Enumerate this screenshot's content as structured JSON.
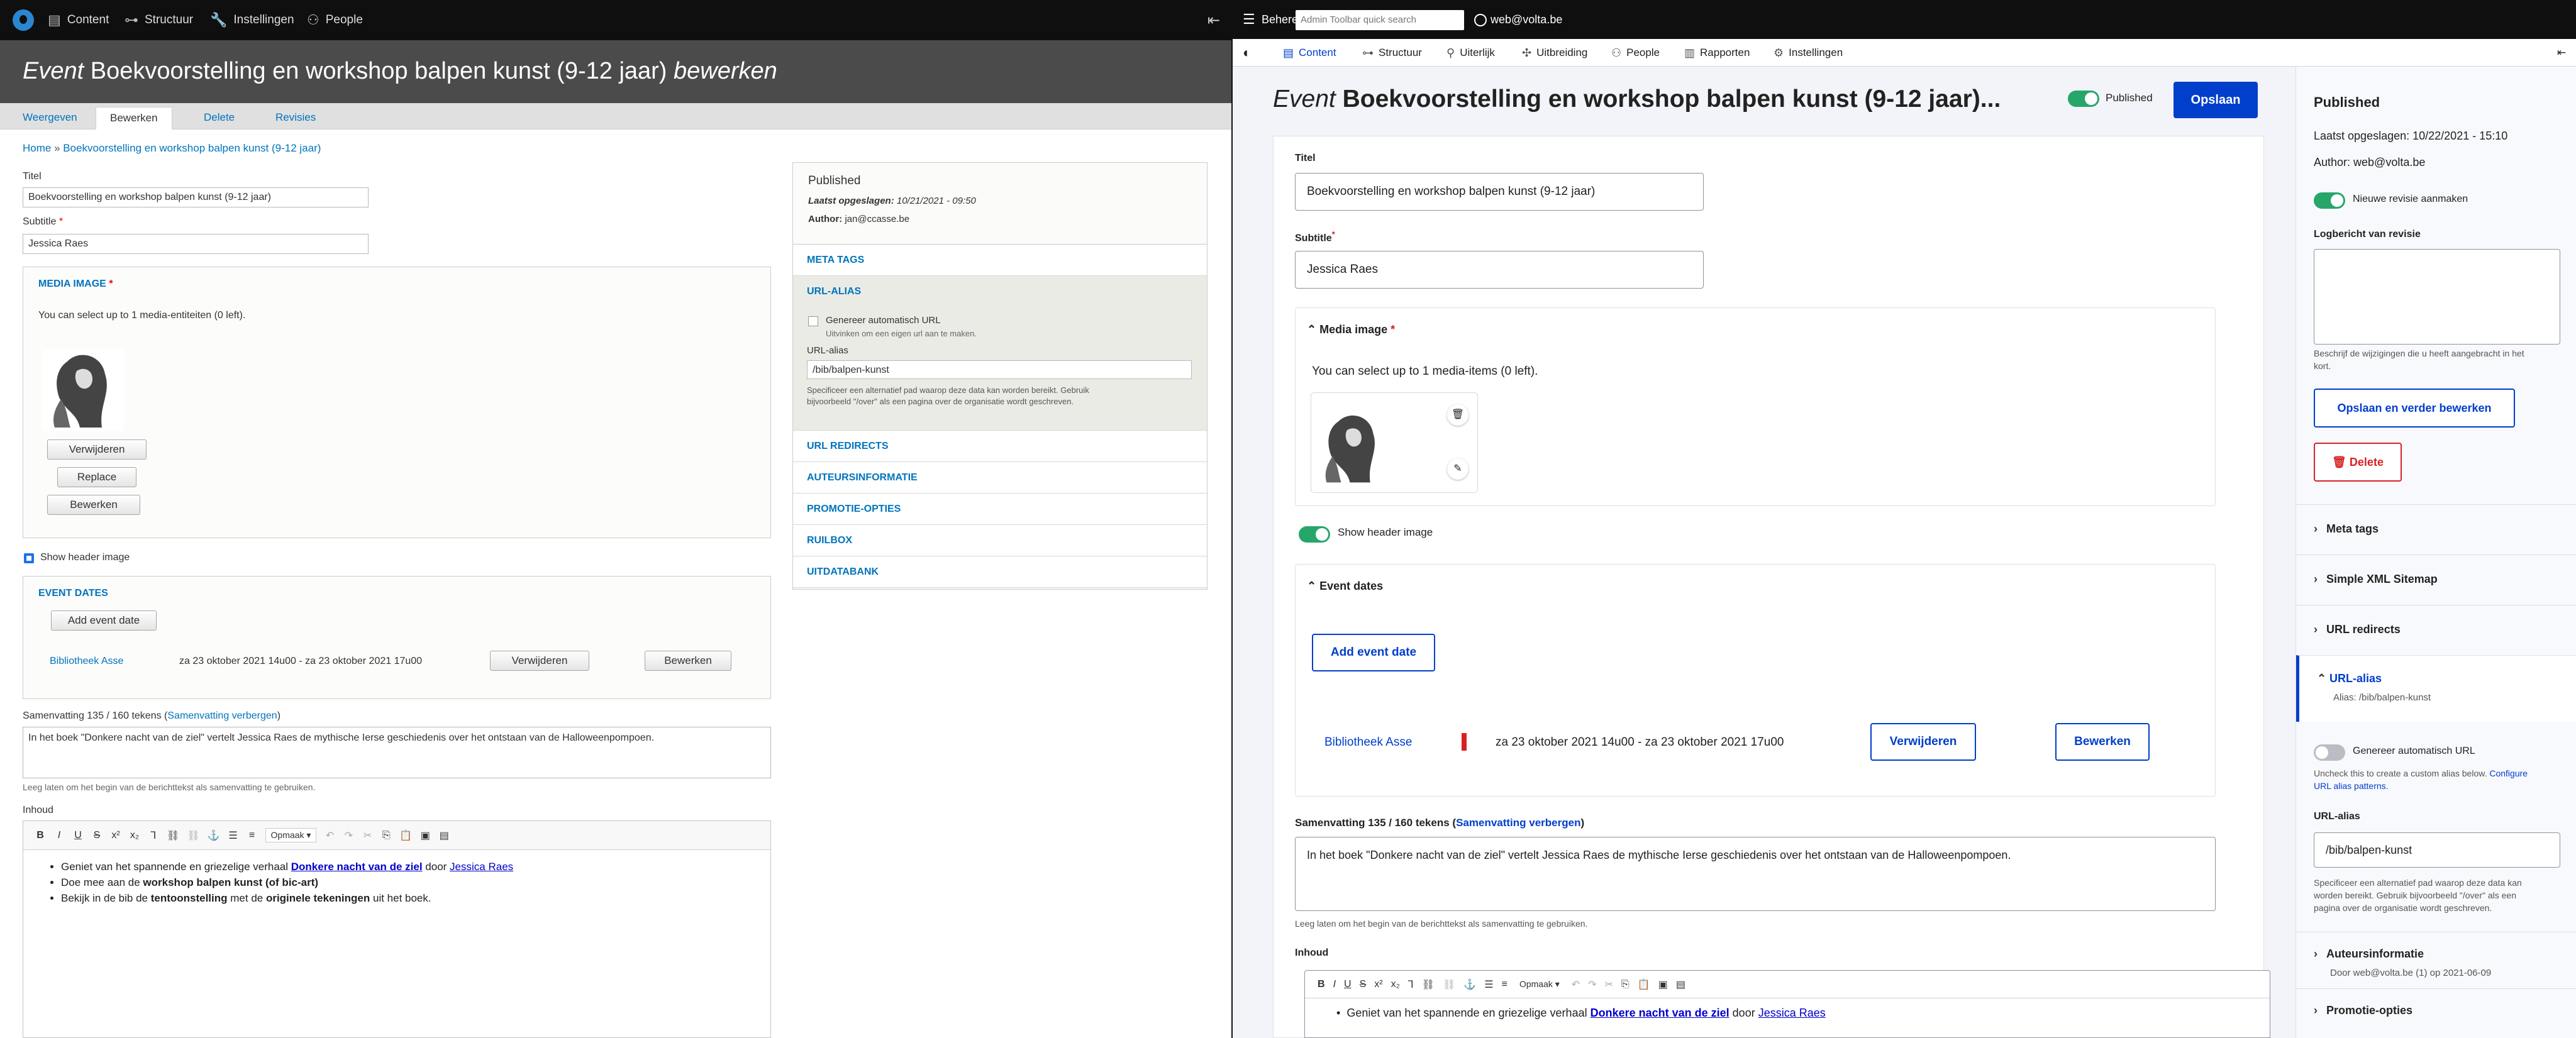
{
  "left": {
    "toolbar": {
      "items": [
        "Content",
        "Structuur",
        "Instellingen",
        "People"
      ]
    },
    "title": {
      "prefix": "Event",
      "main": "Boekvoorstelling en workshop balpen kunst (9-12 jaar)",
      "suffix": "bewerken"
    },
    "tabs": [
      "Weergeven",
      "Bewerken",
      "Delete",
      "Revisies"
    ],
    "breadcrumb": {
      "home": "Home",
      "sep": "»",
      "current": "Boekvoorstelling en workshop balpen kunst (9-12 jaar)"
    },
    "fields": {
      "titel_label": "Titel",
      "titel_value": "Boekvoorstelling en workshop balpen kunst (9-12 jaar)",
      "subtitle_label": "Subtitle",
      "subtitle_value": "Jessica Raes",
      "required_mark": "*"
    },
    "media": {
      "legend": "MEDIA IMAGE",
      "help": "You can select up to 1 media-entiteiten (0 left).",
      "btn_remove": "Verwijderen",
      "btn_replace": "Replace",
      "btn_edit": "Bewerken"
    },
    "show_header": "Show header image",
    "event_dates": {
      "legend": "EVENT DATES",
      "add": "Add event date",
      "location": "Bibliotheek Asse",
      "range": "za 23 oktober 2021 14u00 - za 23 oktober 2021 17u00",
      "btn_remove": "Verwijderen",
      "btn_edit": "Bewerken"
    },
    "summary": {
      "label": "Samenvatting 135 / 160 tekens",
      "toggle": "Samenvatting verbergen",
      "value": "In het boek \"Donkere nacht van de ziel\" vertelt Jessica Raes de mythische Ierse geschiedenis over het ontstaan van de Halloweenpompoen.",
      "help": "Leeg laten om het begin van de berichttekst als samenvatting te gebruiken."
    },
    "inhoud_label": "Inhoud",
    "editor": {
      "format": "Opmaak",
      "line1_pre": "Geniet van het spannende en griezelige verhaal ",
      "line1_link": "Donkere nacht van de ziel",
      "line1_mid": " door ",
      "line1_link2": "Jessica Raes",
      "line2_pre": "Doe mee aan de ",
      "line2_bold": "workshop balpen kunst (of bic-art)",
      "line3_pre": "Bekijk in de bib de ",
      "line3_bold1": "tentoonstelling",
      "line3_mid": " met de ",
      "line3_bold2": "originele tekeningen",
      "line3_post": " uit het boek."
    },
    "side": {
      "status": "Published",
      "saved_label": "Laatst opgeslagen:",
      "saved_value": "10/21/2021 - 09:50",
      "author_label": "Author:",
      "author_value": "jan@ccasse.be",
      "sections": [
        "META TAGS",
        "URL-ALIAS",
        "URL REDIRECTS",
        "AUTEURSINFORMATIE",
        "PROMOTIE-OPTIES",
        "RUILBOX",
        "UITDATABANK"
      ],
      "auto_url": "Genereer automatisch URL",
      "auto_url_help": "Uitvinken om een eigen url aan te maken.",
      "alias_label": "URL-alias",
      "alias_value": "/bib/balpen-kunst",
      "alias_help1": "Specificeer een alternatief pad waarop deze data kan worden bereikt. Gebruik",
      "alias_help2": "bijvoorbeeld \"/over\" als een pagina over de organisatie wordt geschreven."
    }
  },
  "right": {
    "toolbar": {
      "manage": "Beheren",
      "search_placeholder": "Admin Toolbar quick search",
      "user": "web@volta.be"
    },
    "nav": [
      "Content",
      "Structuur",
      "Uiterlijk",
      "Uitbreiding",
      "People",
      "Rapporten",
      "Instellingen"
    ],
    "title": {
      "prefix": "Event",
      "main": "Boekvoorstelling en workshop balpen kunst (9-12 jaar)..."
    },
    "published_toggle": "Published",
    "save": "Opslaan",
    "fields": {
      "titel_label": "Titel",
      "titel_value": "Boekvoorstelling en workshop balpen kunst (9-12 jaar)",
      "subtitle_label": "Subtitle",
      "subtitle_value": "Jessica Raes",
      "required_mark": "*"
    },
    "media": {
      "legend": "Media image",
      "help": "You can select up to 1 media-items (0 left)."
    },
    "show_header": "Show header image",
    "event_dates": {
      "legend": "Event dates",
      "add": "Add event date",
      "location": "Bibliotheek Asse",
      "range": "za 23 oktober 2021 14u00 - za 23 oktober 2021 17u00",
      "btn_remove": "Verwijderen",
      "btn_edit": "Bewerken"
    },
    "summary": {
      "label": "Samenvatting 135 / 160 tekens",
      "toggle": "Samenvatting verbergen",
      "value": "In het boek \"Donkere nacht van de ziel\" vertelt Jessica Raes de mythische Ierse geschiedenis over het ontstaan van de Halloweenpompoen.",
      "help": "Leeg laten om het begin van de berichttekst als samenvatting te gebruiken."
    },
    "inhoud_label": "Inhoud",
    "editor": {
      "format": "Opmaak",
      "line1_pre": "Geniet van het spannende en griezelige verhaal ",
      "line1_link": "Donkere nacht van de ziel",
      "line1_mid": " door ",
      "line1_link2": "Jessica Raes"
    },
    "side": {
      "status": "Published",
      "saved": "Laatst opgeslagen: 10/22/2021 - 15:10",
      "author": "Author: web@volta.be",
      "new_revision": "Nieuwe revisie aanmaken",
      "log_label": "Logbericht van revisie",
      "log_help": "Beschrijf de wijzigingen die u heeft aangebracht in het",
      "log_help2": "kort.",
      "save_continue": "Opslaan en verder bewerken",
      "delete": "Delete",
      "meta_tags": "Meta tags",
      "sitemap": "Simple XML Sitemap",
      "redirects": "URL redirects",
      "alias_section": "URL-alias",
      "alias_sub": "Alias: /bib/balpen-kunst",
      "auto_url": "Genereer automatisch URL",
      "uncheck_help": "Uncheck this to create a custom alias below.",
      "configure_link": "Configure",
      "configure_link2": "URL alias patterns.",
      "alias_label": "URL-alias",
      "alias_value": "/bib/balpen-kunst",
      "alias_help1": "Specificeer een alternatief pad waarop deze data kan",
      "alias_help2": "worden bereikt. Gebruik bijvoorbeeld \"/over\" als een",
      "alias_help3": "pagina over de organisatie wordt geschreven.",
      "author_section": "Auteursinformatie",
      "author_sub": "Door web@volta.be (1) op 2021-06-09",
      "promo": "Promotie-opties"
    }
  },
  "colors": {
    "drupal_blue": "#0074bd",
    "claro_blue": "#003ecc",
    "toggle_green": "#26a769"
  }
}
